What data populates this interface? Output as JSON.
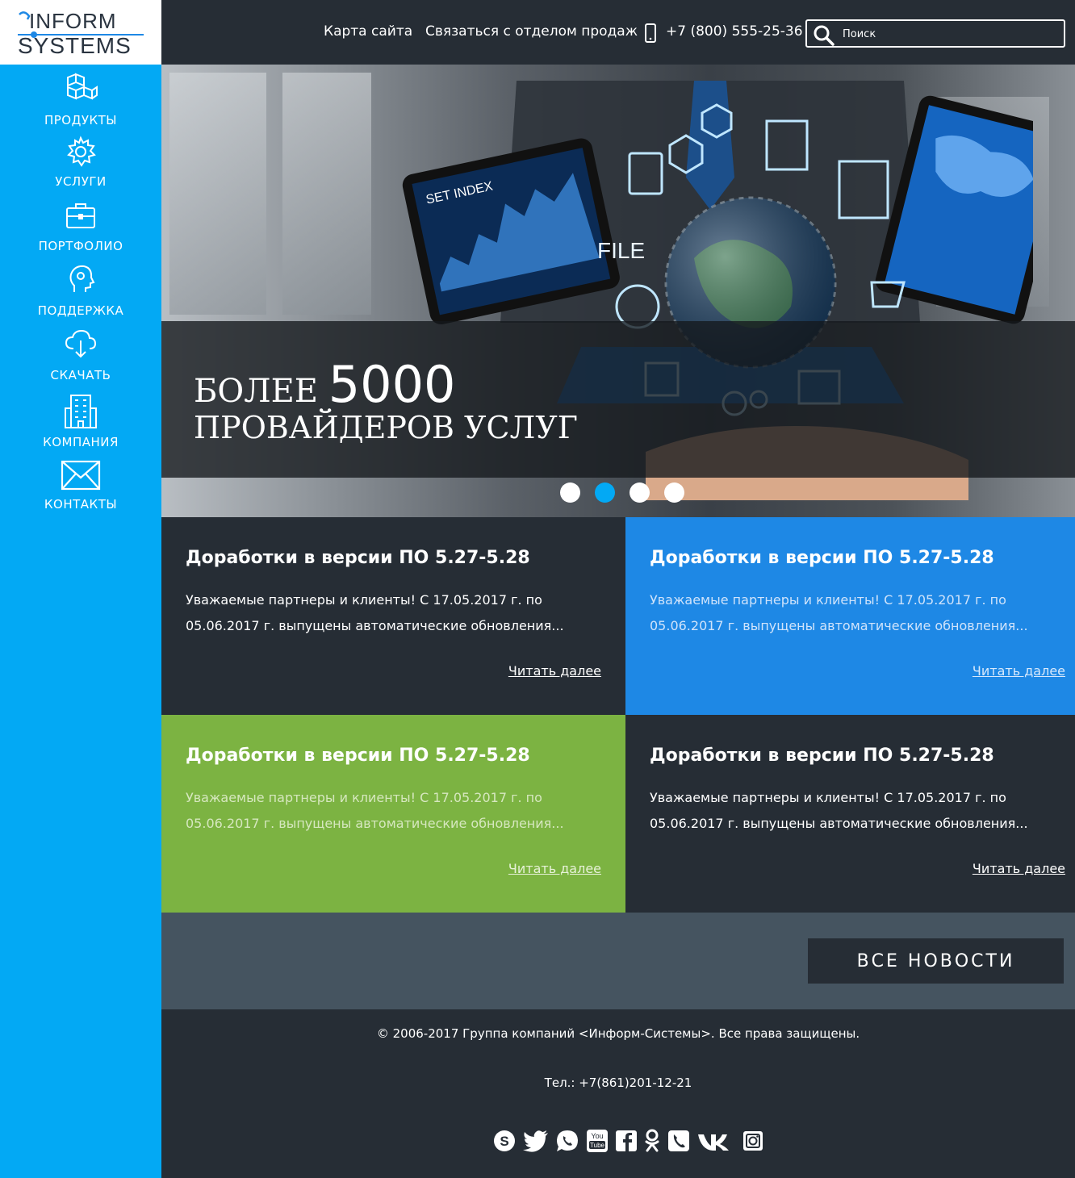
{
  "logo": {
    "line1": "INFORM",
    "line2": "SYSTEMS"
  },
  "sidebar": {
    "items": [
      {
        "label": "ПРОДУКТЫ",
        "icon": "cubes-icon"
      },
      {
        "label": "УСЛУГИ",
        "icon": "gear-icon"
      },
      {
        "label": "ПОРТФОЛИО",
        "icon": "briefcase-icon"
      },
      {
        "label": "ПОДДЕРЖКА",
        "icon": "head-icon"
      },
      {
        "label": "СКАЧАТЬ",
        "icon": "cloud-download-icon"
      },
      {
        "label": "КОМПАНИЯ",
        "icon": "building-icon"
      },
      {
        "label": "КОНТАКТЫ",
        "icon": "envelope-icon"
      }
    ]
  },
  "header": {
    "sitemap": "Карта сайта",
    "contact_sales": "Связаться с отделом продаж",
    "phone": "+7 (800) 555-25-36",
    "search_placeholder": "Поиск"
  },
  "hero": {
    "line1_prefix": "БОЛЕЕ",
    "line1_number": "5000",
    "line2": "ПРОВАЙДЕРОВ УСЛУГ",
    "active_slide": 2,
    "slide_count": 4
  },
  "news": [
    {
      "title": "Доработки в версии ПО 5.27-5.28",
      "text": "Уважаемые партнеры и клиенты! С 17.05.2017 г. по 05.06.2017 г. выпущены автоматические обновления...",
      "link": "Читать далее",
      "color": "#262d35"
    },
    {
      "title": "Доработки в версии ПО 5.27-5.28",
      "text": "Уважаемые партнеры и клиенты! С 17.05.2017 г. по 05.06.2017 г. выпущены автоматические обновления...",
      "link": "Читать далее",
      "color": "#1e88e5"
    },
    {
      "title": "Доработки в версии ПО 5.27-5.28",
      "text": "Уважаемые партнеры и клиенты! С 17.05.2017 г. по 05.06.2017 г. выпущены автоматические обновления...",
      "link": "Читать далее",
      "color": "#7cb342"
    },
    {
      "title": "Доработки в версии ПО 5.27-5.28",
      "text": "Уважаемые партнеры и клиенты! С 17.05.2017 г. по 05.06.2017 г. выпущены автоматические обновления...",
      "link": "Читать далее",
      "color": "#262d35"
    }
  ],
  "all_news_button": "ВСЕ НОВОСТИ",
  "footer": {
    "copyright": "© 2006-2017 Группа компаний <Информ-Системы>. Все права защищены.",
    "tel": "Тел.: +7(861)201-12-21",
    "socials": [
      "skype-icon",
      "twitter-icon",
      "whatsapp-icon",
      "youtube-icon",
      "facebook-icon",
      "odnoklassniki-icon",
      "viber-icon",
      "vk-icon",
      "instagram-icon"
    ]
  },
  "colors": {
    "sidebar": "#03a9f4",
    "dark": "#262d35",
    "blue_card": "#1e88e5",
    "green_card": "#7cb342",
    "bar": "#455460"
  }
}
